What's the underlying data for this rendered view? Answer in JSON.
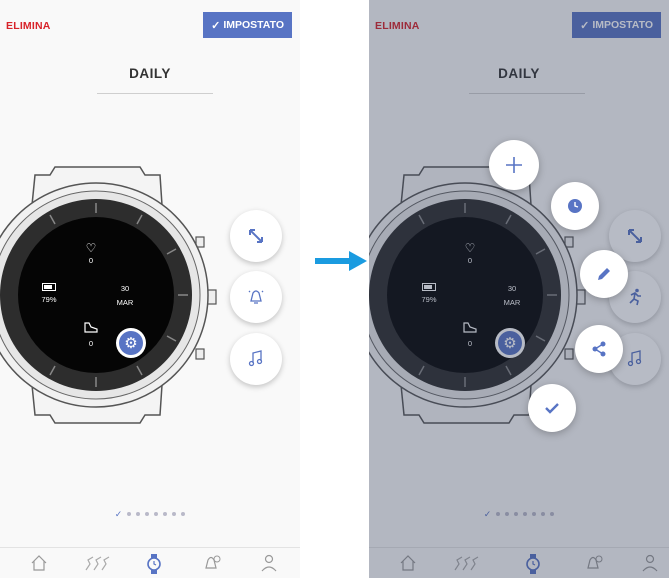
{
  "topbar": {
    "delete_label": "ELIMINA",
    "set_label": "IMPOSTATO"
  },
  "screen": {
    "title": "DAILY"
  },
  "watch_face": {
    "heart_value": "0",
    "battery_value": "79%",
    "day_number": "30",
    "month": "MAR",
    "steps_value": "0"
  },
  "colors": {
    "accent": "#5874c4",
    "danger": "#d8232a"
  },
  "side_buttons": [
    "resize-arrows-icon",
    "alarm-icon",
    "music-note-icon"
  ],
  "right_side_buttons": [
    "resize-arrows-icon",
    "running-icon",
    "music-note-icon"
  ],
  "actions": [
    "plus-icon",
    "watch-icon",
    "pencil-icon",
    "share-icon",
    "check-icon"
  ],
  "pagination": {
    "total": 8,
    "current": 1
  },
  "tabbar": [
    "home-icon",
    "activity-icon",
    "watch-icon",
    "notification-settings-icon",
    "profile-icon"
  ]
}
